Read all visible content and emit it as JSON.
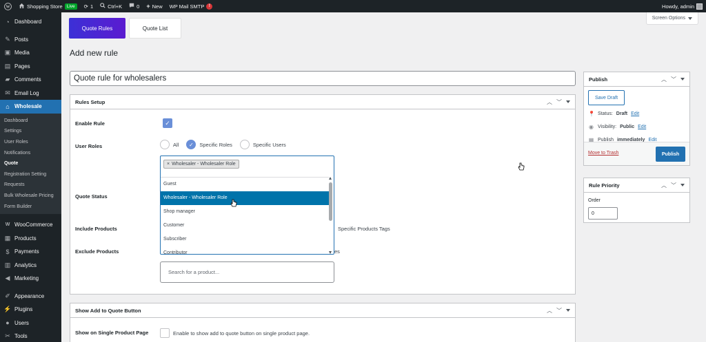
{
  "admin_bar": {
    "site_name": "Shopping Store",
    "live_badge": "Live",
    "updates_count": "1",
    "search_shortcut": "Ctrl+K",
    "comments_count": "0",
    "new_label": "New",
    "smtp_label": "WP Mail SMTP",
    "smtp_alert": "!",
    "howdy": "Howdy, admin"
  },
  "sidebar": {
    "items_top": [
      {
        "label": "Dashboard",
        "icon": "dashboard-icon"
      },
      {
        "label": "Posts",
        "icon": "pin-icon"
      },
      {
        "label": "Media",
        "icon": "media-icon"
      },
      {
        "label": "Pages",
        "icon": "pages-icon"
      },
      {
        "label": "Comments",
        "icon": "comments-icon"
      },
      {
        "label": "Email Log",
        "icon": "email-icon"
      },
      {
        "label": "Wholesale",
        "icon": "store-icon"
      }
    ],
    "submenu": [
      "Dashboard",
      "Settings",
      "User Roles",
      "Notifications",
      "Quote",
      "Registration Setting",
      "Requests",
      "Bulk Wholesale Pricing",
      "Form Builder"
    ],
    "items_bottom": [
      {
        "label": "WooCommerce",
        "icon": "woo-icon"
      },
      {
        "label": "Products",
        "icon": "products-icon"
      },
      {
        "label": "Payments",
        "icon": "payments-icon"
      },
      {
        "label": "Analytics",
        "icon": "analytics-icon"
      },
      {
        "label": "Marketing",
        "icon": "marketing-icon"
      },
      {
        "label": "Appearance",
        "icon": "appearance-icon"
      },
      {
        "label": "Plugins",
        "icon": "plugins-icon"
      },
      {
        "label": "Users",
        "icon": "users-icon"
      },
      {
        "label": "Tools",
        "icon": "tools-icon"
      }
    ]
  },
  "tabs": {
    "quote_rules": "Quote Rules",
    "quote_list": "Quote List"
  },
  "screen_options": "Screen Options",
  "page_title": "Add new rule",
  "rule_title": "Quote rule for wholesalers",
  "rules_setup": {
    "header": "Rules Setup",
    "enable_rule_label": "Enable Rule",
    "user_roles_label": "User Roles",
    "radio_options": [
      "All",
      "Specific Roles",
      "Specific Users"
    ],
    "selected_chip": "Wholesaler - Wholesaler Role",
    "chip_remove": "×",
    "dropdown_options": [
      "Guest",
      "Wholesaler - Wholesaler Role",
      "Shop manager",
      "Customer",
      "Subscriber",
      "Contributor"
    ],
    "highlighted_option": "Wholesaler - Wholesaler Role",
    "quote_status_label": "Quote Status",
    "include_products_label": "Include Products",
    "exclude_products_label": "Exclude Products",
    "include_tags_fragment": "Specific Products Tags",
    "exclude_fragment": "es",
    "search_placeholder": "Search for a product..."
  },
  "show_quote": {
    "header": "Show Add to Quote Button",
    "single_page_label": "Show on Single Product Page",
    "single_page_hint": "Enable to show add to quote button on single product page."
  },
  "publish": {
    "header": "Publish",
    "save_draft": "Save Draft",
    "status_label": "Status:",
    "status_value": "Draft",
    "visibility_label": "Visibility:",
    "visibility_value": "Public",
    "publish_label": "Publish",
    "publish_value": "immediately",
    "edit": "Edit",
    "move_to_trash": "Move to Trash",
    "publish_button": "Publish"
  },
  "rule_priority": {
    "header": "Rule Priority",
    "order_label": "Order",
    "order_value": "0"
  },
  "colors": {
    "admin_dark": "#1d2327",
    "accent_blue": "#2271b1",
    "tab_gradient_start": "#3c30d6",
    "tab_gradient_end": "#5b1bd0",
    "highlight": "#0073aa",
    "live_green": "#00a32a"
  }
}
